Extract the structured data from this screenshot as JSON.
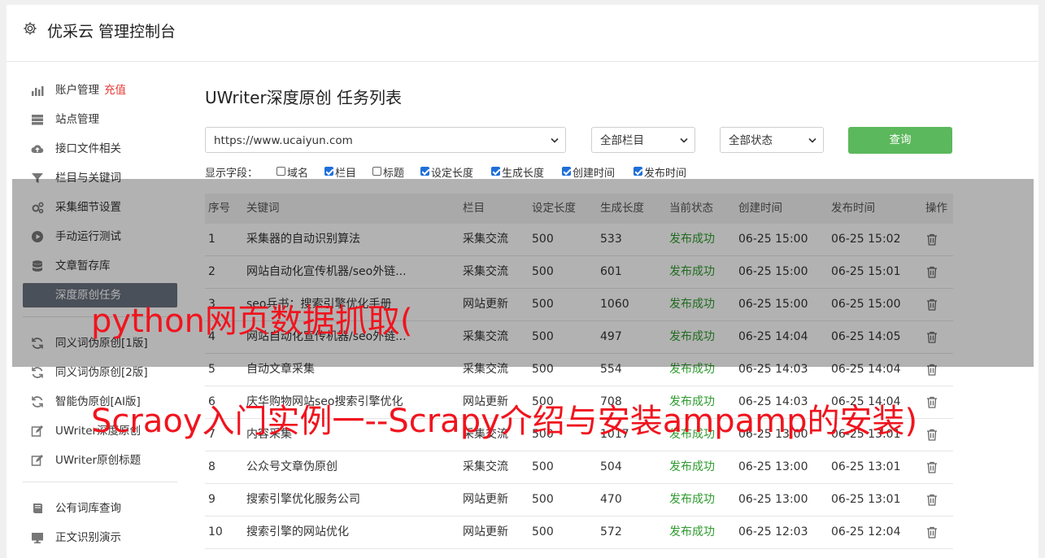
{
  "app": {
    "title": "优采云 管理控制台"
  },
  "sidebar": {
    "items": [
      {
        "label": "账户管理",
        "badge": "充值",
        "icon": "bar-chart-icon"
      },
      {
        "label": "站点管理",
        "icon": "server-icon"
      },
      {
        "label": "接口文件相关",
        "icon": "cloud-upload-icon"
      },
      {
        "label": "栏目与关键词",
        "icon": "filter-icon"
      },
      {
        "label": "采集细节设置",
        "icon": "gears-icon"
      },
      {
        "label": "手动运行测试",
        "icon": "play-circle-icon"
      },
      {
        "label": "文章暂存库",
        "icon": "database-icon"
      },
      {
        "label": "深度原创任务",
        "icon": "edit-icon",
        "active": true
      },
      {
        "label": "同义词伪原创[1版]",
        "icon": "refresh-icon"
      },
      {
        "label": "同义词伪原创[2版]",
        "icon": "refresh-icon"
      },
      {
        "label": "智能伪原创[AI版]",
        "icon": "refresh-icon"
      },
      {
        "label": "UWriter深度原创",
        "icon": "edit-icon"
      },
      {
        "label": "UWriter原创标题",
        "icon": "edit-icon"
      },
      {
        "label": "公有词库查询",
        "icon": "book-icon"
      },
      {
        "label": "正文识别演示",
        "icon": "monitor-icon"
      }
    ]
  },
  "main": {
    "title": "UWriter深度原创 任务列表",
    "site_select": "https://www.ucaiyun.com",
    "column_select": "全部栏目",
    "status_select": "全部状态",
    "query_button": "查询",
    "fields_label": "显示字段：",
    "fields": [
      {
        "label": "域名",
        "checked": false
      },
      {
        "label": "栏目",
        "checked": true
      },
      {
        "label": "标题",
        "checked": false
      },
      {
        "label": "设定长度",
        "checked": true
      },
      {
        "label": "生成长度",
        "checked": true
      },
      {
        "label": "创建时间",
        "checked": true
      },
      {
        "label": "发布时间",
        "checked": true
      }
    ],
    "table": {
      "headers": [
        "序号",
        "关键词",
        "栏目",
        "设定长度",
        "生成长度",
        "当前状态",
        "创建时间",
        "发布时间",
        "操作"
      ],
      "rows": [
        [
          "1",
          "采集器的自动识别算法",
          "采集交流",
          "500",
          "533",
          "发布成功",
          "06-25 15:00",
          "06-25 15:02"
        ],
        [
          "2",
          "网站自动化宣传机器/seo外链...",
          "采集交流",
          "500",
          "601",
          "发布成功",
          "06-25 15:00",
          "06-25 15:01"
        ],
        [
          "3",
          "seo兵书：搜索引擎优化手册",
          "网站更新",
          "500",
          "1060",
          "发布成功",
          "06-25 15:00",
          "06-25 15:00"
        ],
        [
          "4",
          "网站自动化宣传机器/seo外链...",
          "采集交流",
          "500",
          "497",
          "发布成功",
          "06-25 14:04",
          "06-25 14:05"
        ],
        [
          "5",
          "自动文章采集",
          "采集交流",
          "500",
          "554",
          "发布成功",
          "06-25 14:03",
          "06-25 14:04"
        ],
        [
          "6",
          "庆华购物网站seo搜索引擎优化",
          "网站更新",
          "500",
          "708",
          "发布成功",
          "06-25 14:03",
          "06-25 14:04"
        ],
        [
          "7",
          "内容采集",
          "采集交流",
          "500",
          "1017",
          "发布成功",
          "06-25 13:00",
          "06-25 13:01"
        ],
        [
          "8",
          "公众号文章伪原创",
          "采集交流",
          "500",
          "504",
          "发布成功",
          "06-25 13:00",
          "06-25 13:01"
        ],
        [
          "9",
          "搜索引擎优化服务公司",
          "网站更新",
          "500",
          "470",
          "发布成功",
          "06-25 13:00",
          "06-25 13:01"
        ],
        [
          "10",
          "搜索引擎的网站优化",
          "网站更新",
          "500",
          "572",
          "发布成功",
          "06-25 12:03",
          "06-25 12:04"
        ]
      ]
    }
  },
  "overlay_text": {
    "line1": "python网页数据抓取(",
    "line2": "Scraoy入门实例一--Scrapy介绍与安装ampamp的安装)"
  },
  "colors": {
    "accent_green": "#5cb85c",
    "active_sidebar": "#6b7380",
    "badge_red": "#e53935",
    "status_green": "#2e9b2e",
    "banner_red": "#f0141e"
  }
}
